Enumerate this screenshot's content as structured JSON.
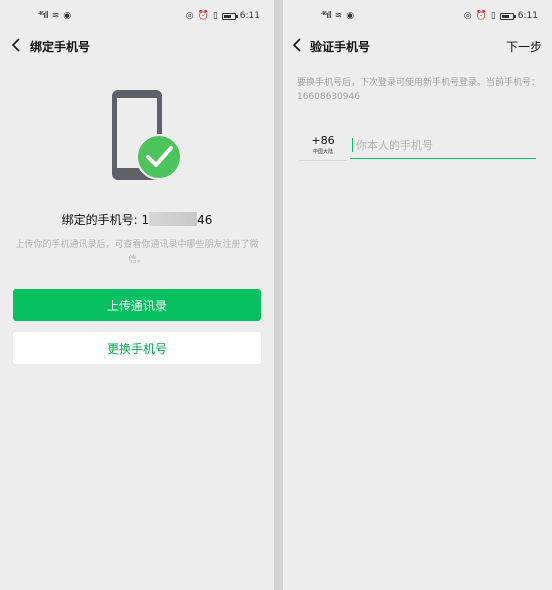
{
  "status_bar": {
    "signal_text": "⁴⁶ᵢₗₗ",
    "time": "6:11"
  },
  "left_screen": {
    "title": "绑定手机号",
    "bound_label": "绑定的手机号: 1",
    "bound_suffix": "46",
    "hint": "上传你的手机通讯录后，可查看你通讯录中哪些朋友注册了微信。",
    "upload_button": "上传通讯录",
    "change_button": "更换手机号",
    "accent_color": "#07c160"
  },
  "right_screen": {
    "title": "验证手机号",
    "next_button": "下一步",
    "description": "要换手机号后，下次登录可使用新手机号登录。当前手机号：16608630946",
    "country_code": "+86",
    "country_name": "中国大陆",
    "phone_placeholder": "你本人的手机号"
  }
}
